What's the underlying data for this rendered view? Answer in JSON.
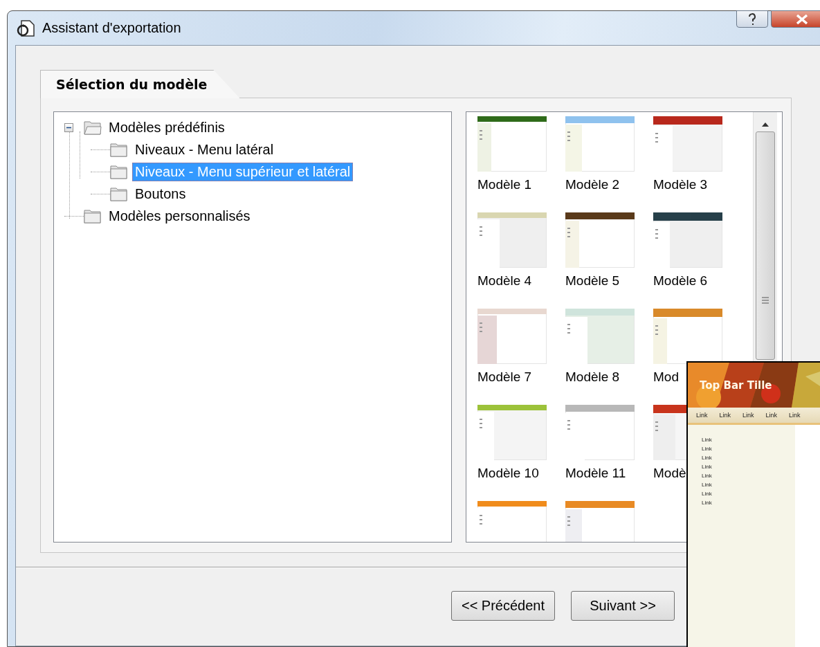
{
  "window": {
    "title": "Assistant d'exportation"
  },
  "tabs": [
    {
      "label": "Sélection du modèle",
      "selected": true
    }
  ],
  "tree": [
    {
      "label": "Modèles prédéfinis",
      "expanded": true,
      "selected": false,
      "children": [
        {
          "label": "Niveaux - Menu latéral",
          "selected": false
        },
        {
          "label": "Niveaux - Menu supérieur et latéral",
          "selected": true
        },
        {
          "label": "Boutons",
          "selected": false
        }
      ]
    },
    {
      "label": "Modèles personnalisés",
      "selected": false
    }
  ],
  "templates": [
    {
      "kind": "template",
      "label": "Modèle 1"
    },
    {
      "kind": "template",
      "label": "Modèle 2"
    },
    {
      "kind": "template",
      "label": "Modèle 3"
    },
    {
      "kind": "template",
      "label": "Modèle 4"
    },
    {
      "kind": "template",
      "label": "Modèle 5"
    },
    {
      "kind": "template",
      "label": "Modèle 6"
    },
    {
      "kind": "template",
      "label": "Modèle 7"
    },
    {
      "kind": "template",
      "label": "Modèle 8"
    },
    {
      "kind": "template",
      "label": "Mod"
    },
    {
      "kind": "template",
      "label": "Modèle 10"
    },
    {
      "kind": "template",
      "label": "Modèle 11"
    },
    {
      "kind": "template",
      "label": "Modè"
    },
    {
      "kind": "template"
    },
    {
      "kind": "template"
    }
  ],
  "buttons": [
    {
      "label": "<< Précédent"
    },
    {
      "label": "Suivant >>"
    }
  ],
  "preview": {
    "title": "Top Bar Tille",
    "nav_links": [
      "Link",
      "Link",
      "Link",
      "Link",
      "Link"
    ],
    "side_links": [
      "Link",
      "Link",
      "Link",
      "Link",
      "Link",
      "Link",
      "Link",
      "Link"
    ]
  }
}
